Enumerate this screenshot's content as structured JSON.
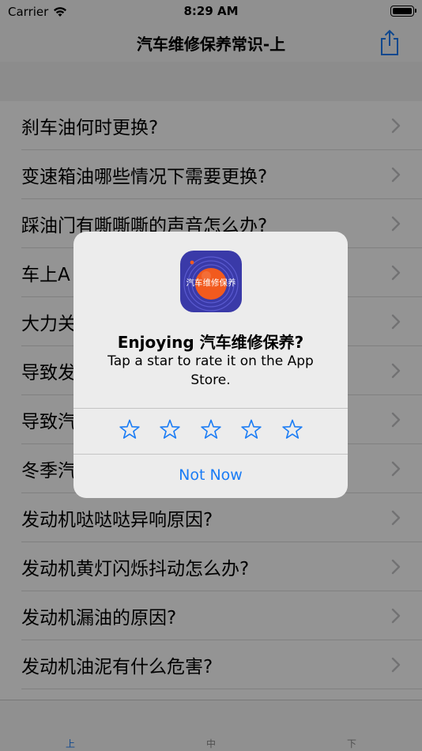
{
  "status_bar": {
    "carrier": "Carrier",
    "time": "8:29 AM"
  },
  "nav": {
    "title": "汽车维修保养常识-上"
  },
  "list": {
    "items": [
      "刹车油何时更换?",
      "变速箱油哪些情况下需要更换?",
      "踩油门有嘶嘶嘶的声音怎么办?",
      "车上A",
      "大力关",
      "导致发",
      "导致汽",
      "冬季汽",
      "发动机哒哒哒异响原因?",
      "发动机黄灯闪烁抖动怎么办?",
      "发动机漏油的原因?",
      "发动机油泥有什么危害?"
    ]
  },
  "tabs": [
    "上",
    "中",
    "下"
  ],
  "alert": {
    "icon_text": "汽车维修保养",
    "title": "Enjoying 汽车维修保养?",
    "message": "Tap a star to rate it on the App Store.",
    "stars": 5,
    "dismiss": "Not Now"
  },
  "colors": {
    "accent": "#1a7cf5",
    "active_tab": "#1a7cf5",
    "icon_bg": "#3a3aa8",
    "icon_circle": "#f25a1e"
  }
}
